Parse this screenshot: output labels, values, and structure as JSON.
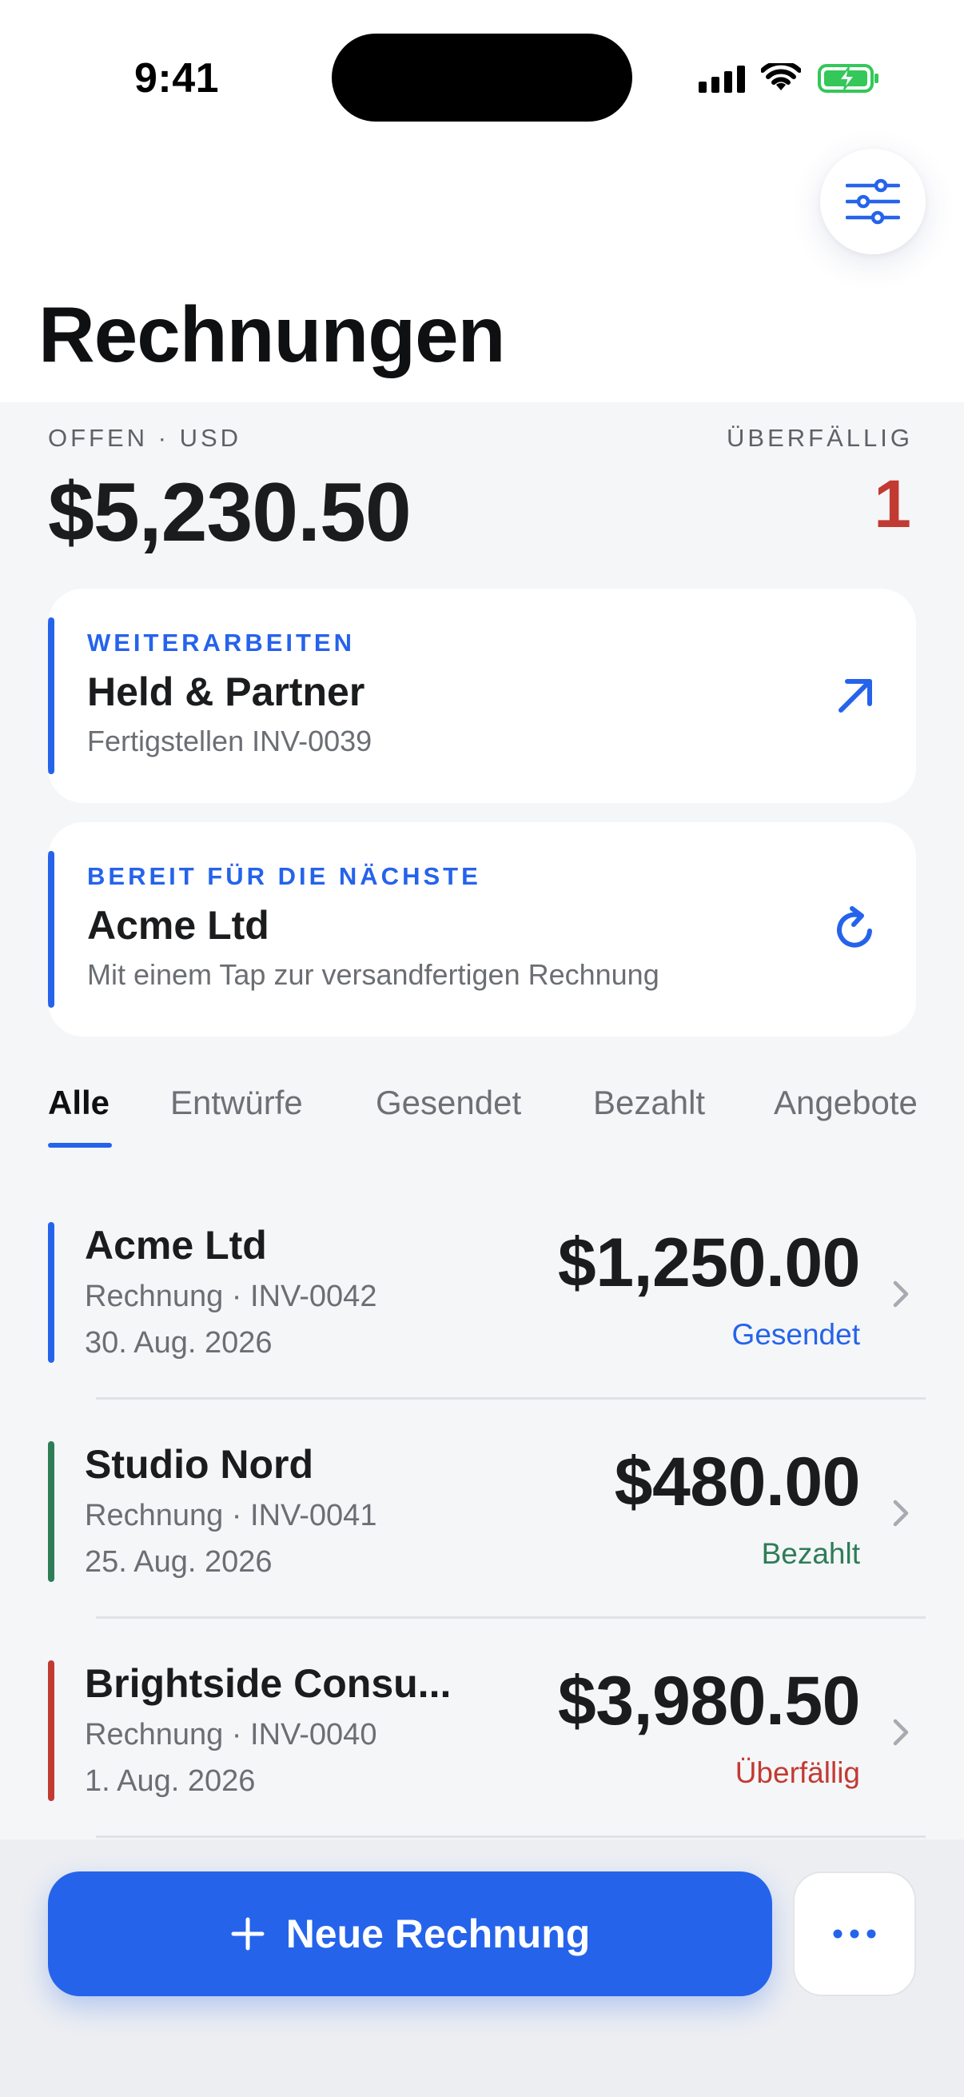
{
  "status_bar": {
    "time": "9:41"
  },
  "header": {
    "title": "Rechnungen",
    "filter_icon": "sliders-icon"
  },
  "summary": {
    "open_label": "OFFEN · USD",
    "open_amount": "$5,230.50",
    "overdue_label": "ÜBERFÄLLIG",
    "overdue_count": "1"
  },
  "cards": [
    {
      "eyebrow": "WEITERARBEITEN",
      "title": "Held & Partner",
      "subtitle": "Fertigstellen INV-0039",
      "icon": "arrow-up-right-icon"
    },
    {
      "eyebrow": "BEREIT FÜR DIE NÄCHSTE",
      "title": "Acme Ltd",
      "subtitle": "Mit einem Tap zur versandfertigen Rechnung",
      "icon": "refresh-icon"
    }
  ],
  "tabs": [
    {
      "label": "Alle",
      "active": true
    },
    {
      "label": "Entwürfe"
    },
    {
      "label": "Gesendet"
    },
    {
      "label": "Bezahlt"
    },
    {
      "label": "Angebote"
    }
  ],
  "invoices": [
    {
      "client": "Acme Ltd",
      "meta": "Rechnung · INV-0042",
      "date": "30. Aug. 2026",
      "amount": "$1,250.00",
      "status": "Gesendet",
      "color": "#2563eb"
    },
    {
      "client": "Studio Nord",
      "meta": "Rechnung · INV-0041",
      "date": "25. Aug. 2026",
      "amount": "$480.00",
      "status": "Bezahlt",
      "color": "#2e7d57"
    },
    {
      "client": "Brightside Consu...",
      "meta": "Rechnung · INV-0040",
      "date": "1. Aug. 2026",
      "amount": "$3,980.50",
      "status": "Überfällig",
      "color": "#c23b33"
    }
  ],
  "actions": {
    "primary_label": "Neue Rechnung",
    "primary_icon": "plus-icon",
    "more_icon": "more-icon"
  },
  "colors": {
    "accent": "#2563eb",
    "paid": "#2e7d57",
    "overdue": "#c23b33"
  }
}
